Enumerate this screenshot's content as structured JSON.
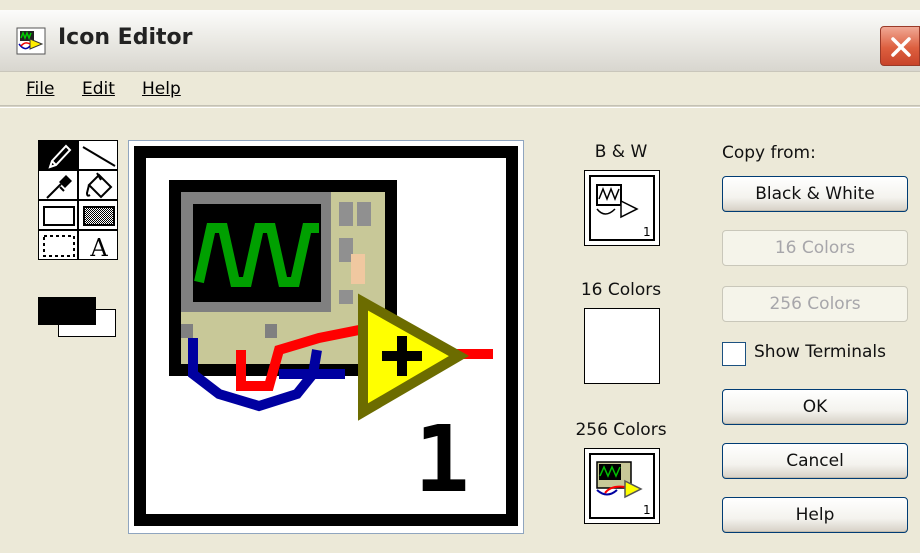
{
  "window": {
    "title": "Icon Editor",
    "app_icon": "labview-vi-icon"
  },
  "menu": [
    {
      "label": "File"
    },
    {
      "label": "Edit"
    },
    {
      "label": "Help"
    }
  ],
  "tools": [
    {
      "name": "pencil-icon",
      "selected": true
    },
    {
      "name": "line-icon",
      "selected": false
    },
    {
      "name": "color-picker-icon",
      "selected": false
    },
    {
      "name": "fill-bucket-icon",
      "selected": false
    },
    {
      "name": "rectangle-icon",
      "selected": false
    },
    {
      "name": "filled-rectangle-icon",
      "selected": false
    },
    {
      "name": "select-marquee-icon",
      "selected": false
    },
    {
      "name": "text-icon",
      "selected": false,
      "glyph": "A"
    }
  ],
  "colors": {
    "foreground": "#000000",
    "background": "#ffffff",
    "scope_green": "#00a000",
    "wire_red": "#ff0000",
    "wire_blue": "#0000a0",
    "amp_yellow": "#ffff00",
    "bezel_tan": "#c8c898"
  },
  "canvas": {
    "number_label": "1"
  },
  "previews": {
    "bw": {
      "label": "B & W",
      "number": "1"
    },
    "c16": {
      "label": "16 Colors"
    },
    "c256": {
      "label": "256 Colors",
      "number": "1"
    }
  },
  "copy_from": {
    "label": "Copy from:",
    "buttons": [
      {
        "label": "Black & White",
        "enabled": true
      },
      {
        "label": "16 Colors",
        "enabled": false
      },
      {
        "label": "256 Colors",
        "enabled": false
      }
    ]
  },
  "show_terminals": {
    "label": "Show Terminals",
    "checked": false
  },
  "actions": {
    "ok": "OK",
    "cancel": "Cancel",
    "help": "Help"
  }
}
